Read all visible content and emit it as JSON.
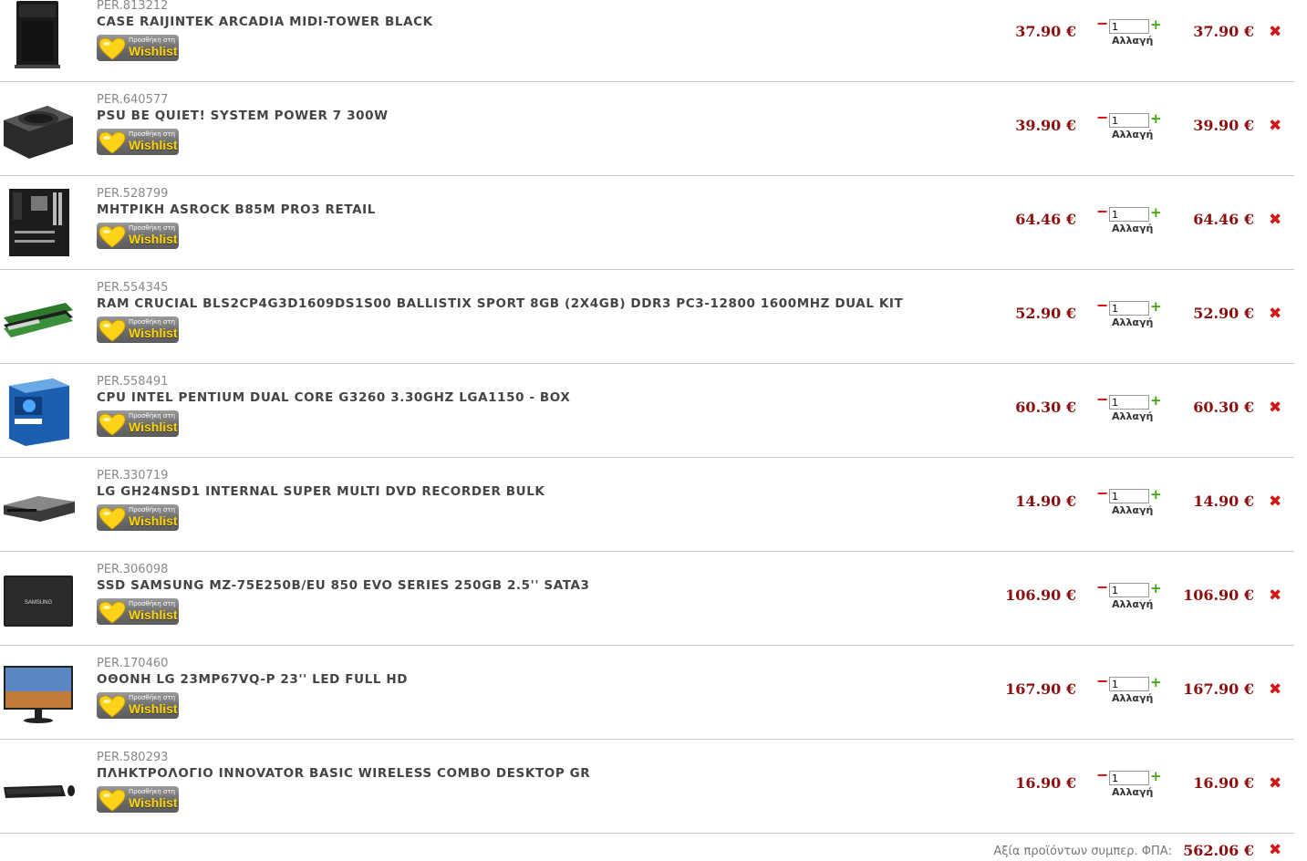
{
  "cart": {
    "wishlist_small": "Προσθήκη στη",
    "wishlist_big": "Wishlist",
    "change_label": "Αλλαγή",
    "minus_glyph": "−",
    "plus_glyph": "+",
    "remove_glyph": "✖",
    "items": [
      {
        "code": "PER.813212",
        "name": "CASE RAIJINTEK ARCADIA MIDI-TOWER BLACK",
        "unit_price": "37.90 €",
        "qty": "1",
        "total": "37.90 €",
        "image": "pc-case"
      },
      {
        "code": "PER.640577",
        "name": "PSU BE QUIET! SYSTEM POWER 7 300W",
        "unit_price": "39.90 €",
        "qty": "1",
        "total": "39.90 €",
        "image": "power-supply"
      },
      {
        "code": "PER.528799",
        "name": "ΜΗΤΡΙΚΗ ASROCK B85M PRO3 RETAIL",
        "unit_price": "64.46 €",
        "qty": "1",
        "total": "64.46 €",
        "image": "motherboard"
      },
      {
        "code": "PER.554345",
        "name": "RAM CRUCIAL BLS2CP4G3D1609DS1S00 BALLISTIX SPORT 8GB (2X4GB) DDR3 PC3-12800 1600MHZ DUAL KIT",
        "unit_price": "52.90 €",
        "qty": "1",
        "total": "52.90 €",
        "image": "ram-kit"
      },
      {
        "code": "PER.558491",
        "name": "CPU INTEL PENTIUM DUAL CORE G3260 3.30GHZ LGA1150 - BOX",
        "unit_price": "60.30 €",
        "qty": "1",
        "total": "60.30 €",
        "image": "cpu-box"
      },
      {
        "code": "PER.330719",
        "name": "LG GH24NSD1 INTERNAL SUPER MULTI DVD RECORDER BULK",
        "unit_price": "14.90 €",
        "qty": "1",
        "total": "14.90 €",
        "image": "dvd-drive"
      },
      {
        "code": "PER.306098",
        "name": "SSD SAMSUNG MZ-75E250B/EU 850 EVO SERIES 250GB 2.5'' SATA3",
        "unit_price": "106.90 €",
        "qty": "1",
        "total": "106.90 €",
        "image": "ssd"
      },
      {
        "code": "PER.170460",
        "name": "ΟΘΟΝΗ LG 23MP67VQ-P 23'' LED FULL HD",
        "unit_price": "167.90 €",
        "qty": "1",
        "total": "167.90 €",
        "image": "monitor"
      },
      {
        "code": "PER.580293",
        "name": "ΠΛΗΚΤΡΟΛΟΓΙΟ INNOVATOR BASIC WIRELESS COMBO DESKTOP GR",
        "unit_price": "16.90 €",
        "qty": "1",
        "total": "16.90 €",
        "image": "keyboard"
      }
    ],
    "footer": {
      "label": "Αξία προϊόντων συμπερ. ΦΠΑ:",
      "sum": "562.06 €"
    }
  },
  "colors": {
    "price": "#8b0f0f",
    "remove": "#d01818",
    "minus": "#e00000",
    "plus": "#3aa800",
    "wishlist_text": "#ffd400"
  }
}
